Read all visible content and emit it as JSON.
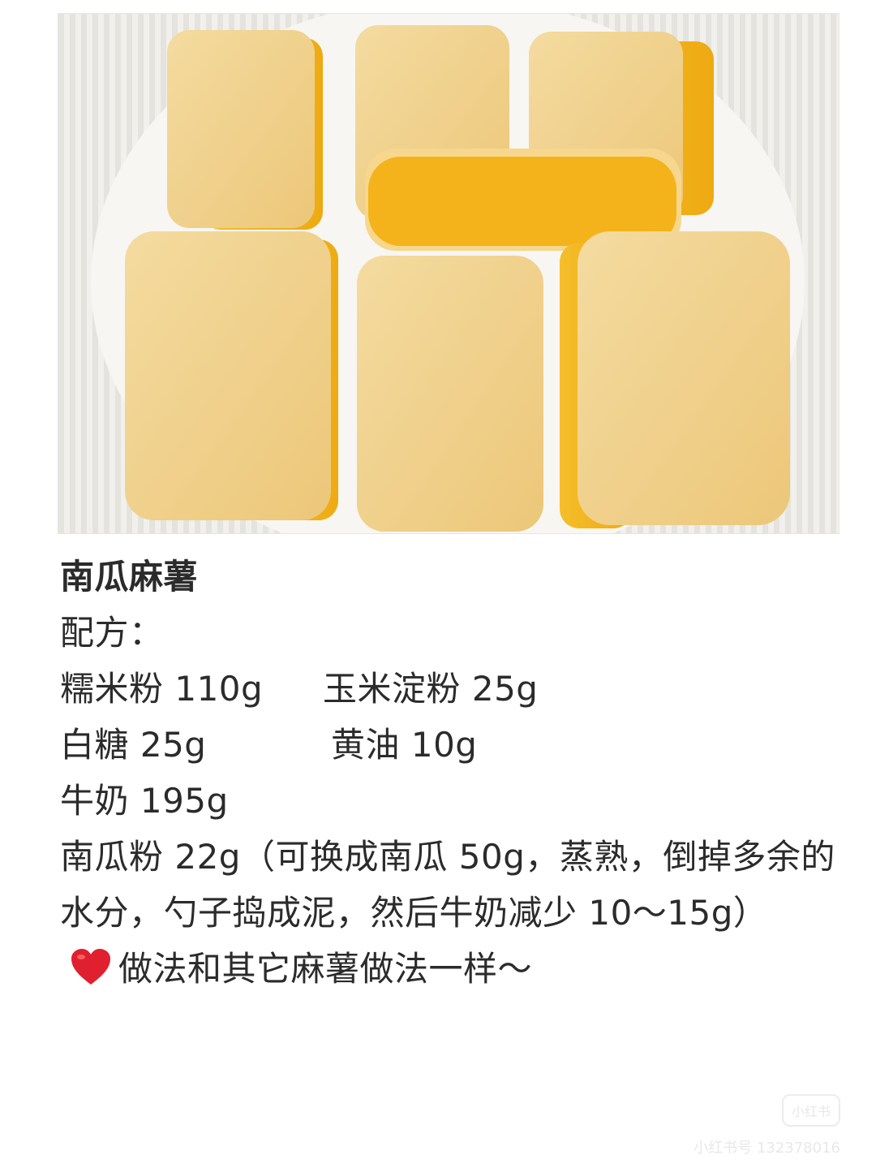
{
  "recipe": {
    "title": "南瓜麻薯",
    "formula_label": "配方：",
    "ingredients_row1": [
      "糯米粉 110g",
      "玉米淀粉 25g"
    ],
    "ingredients_row2": [
      "白糖 25g",
      "黄油 10g"
    ],
    "milk": "牛奶 195g",
    "pumpkin_powder": "南瓜粉 22g（可换成南瓜 50g，蒸熟，倒掉多余的水分，勺子捣成泥，然后牛奶减少 10～15g）",
    "method": "做法和其它麻薯做法一样～"
  },
  "watermark": {
    "logo": "小红书",
    "id_text": "小红书号 132378016"
  },
  "icons": [
    "heart-icon"
  ],
  "colors": {
    "heart": "#e0202e",
    "mochi": "#f2d48a",
    "filling": "#f3b81e"
  }
}
